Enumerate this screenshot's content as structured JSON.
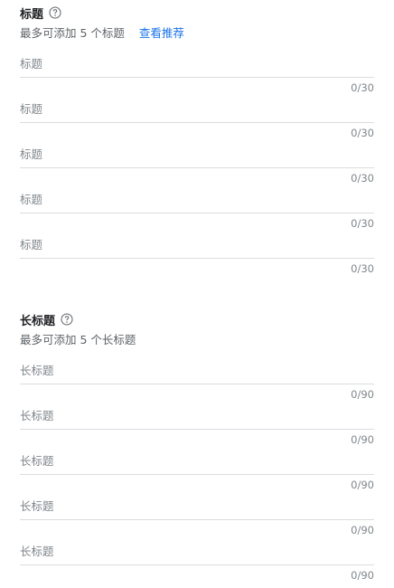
{
  "sections": [
    {
      "title": "标题",
      "help_icon": "help-circle-icon",
      "subtitle": "最多可添加 5 个标题",
      "link": "查看推荐",
      "fields": [
        {
          "placeholder": "标题",
          "value": "",
          "counter": "0/30"
        },
        {
          "placeholder": "标题",
          "value": "",
          "counter": "0/30"
        },
        {
          "placeholder": "标题",
          "value": "",
          "counter": "0/30"
        },
        {
          "placeholder": "标题",
          "value": "",
          "counter": "0/30"
        },
        {
          "placeholder": "标题",
          "value": "",
          "counter": "0/30"
        }
      ]
    },
    {
      "title": "长标题",
      "help_icon": "help-circle-icon",
      "subtitle": "最多可添加 5 个长标题",
      "fields": [
        {
          "placeholder": "长标题",
          "value": "",
          "counter": "0/90"
        },
        {
          "placeholder": "长标题",
          "value": "",
          "counter": "0/90"
        },
        {
          "placeholder": "长标题",
          "value": "",
          "counter": "0/90"
        },
        {
          "placeholder": "长标题",
          "value": "",
          "counter": "0/90"
        },
        {
          "placeholder": "长标题",
          "value": "",
          "counter": "0/90"
        }
      ]
    }
  ],
  "colors": {
    "text": "#202124",
    "muted": "#5f6368",
    "placeholder": "#80868b",
    "link": "#1a73e8",
    "divider": "#dadce0"
  }
}
